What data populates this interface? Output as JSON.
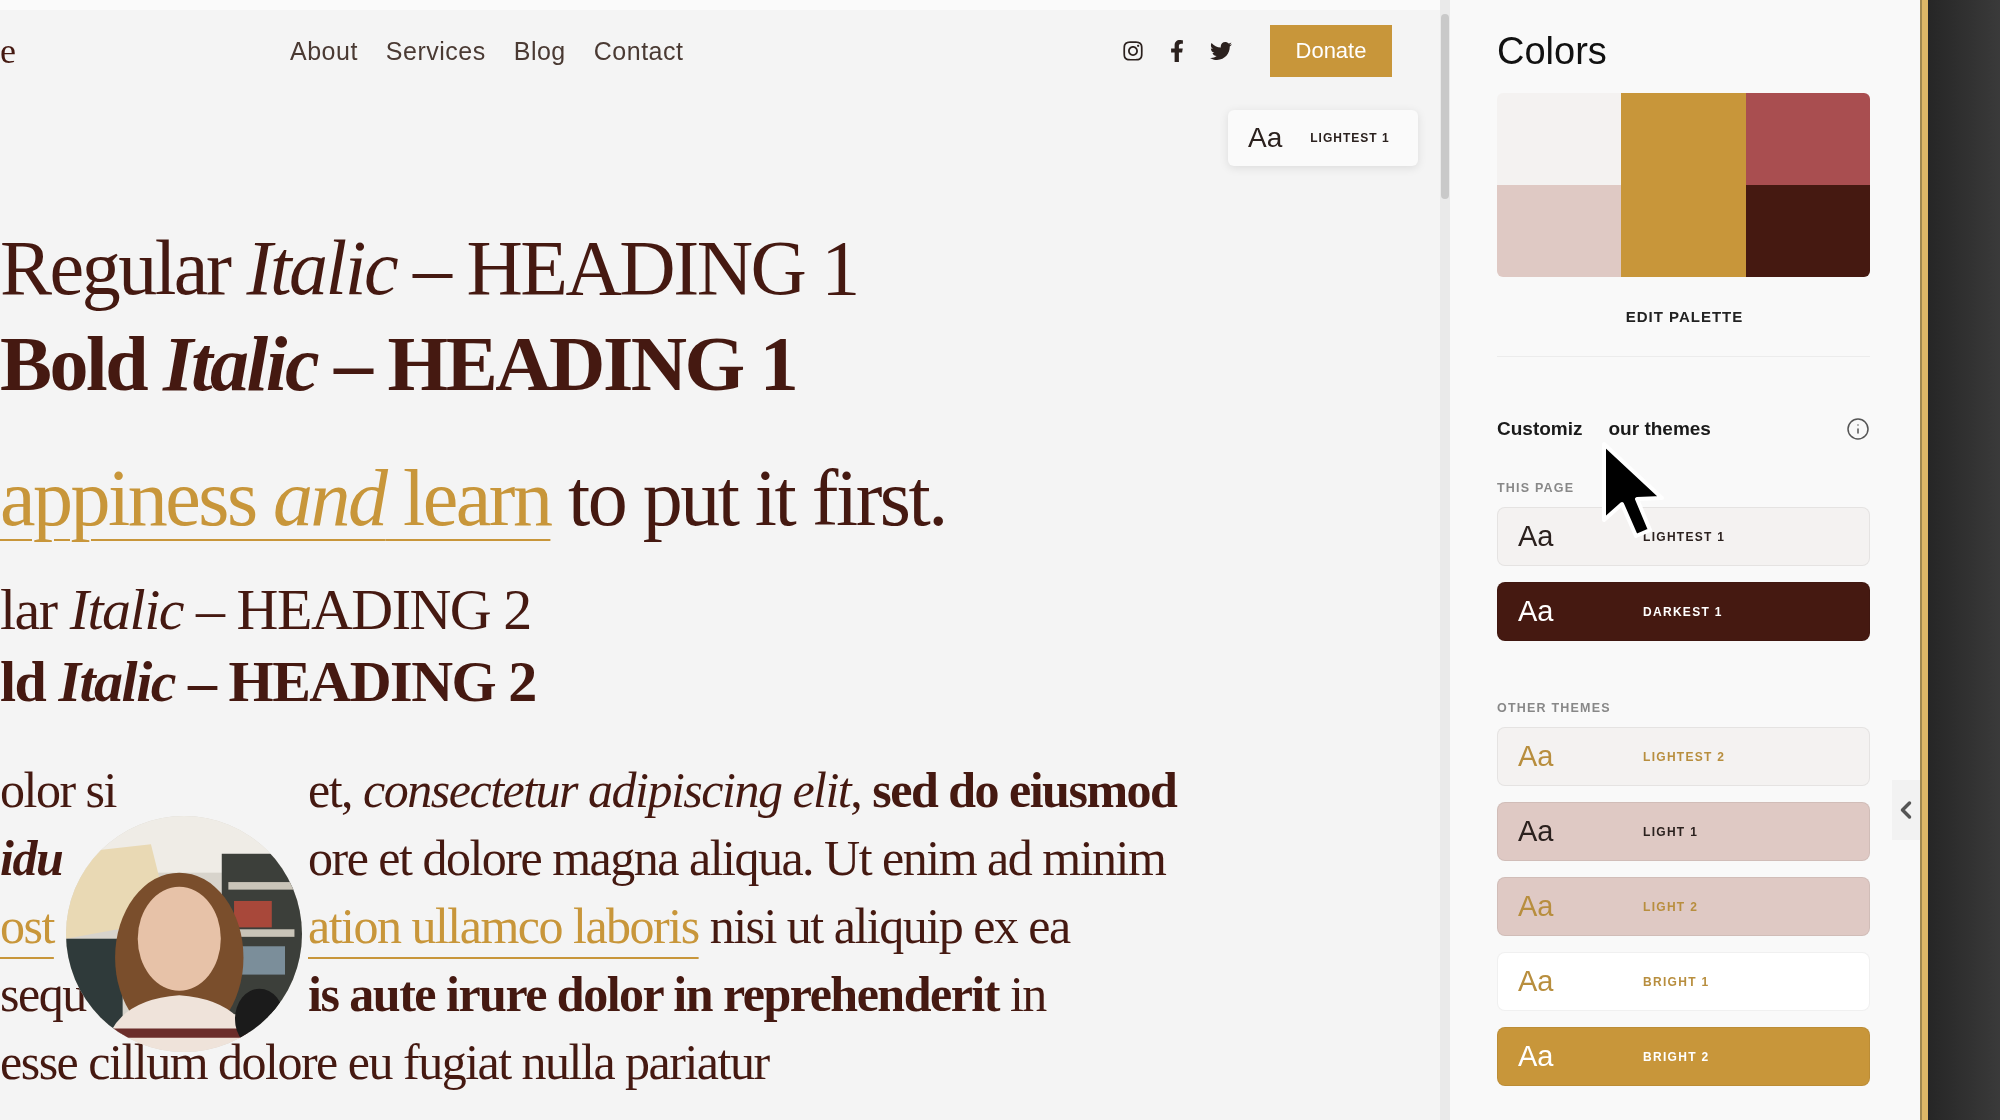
{
  "site": {
    "logo": "e",
    "nav": [
      "About",
      "Services",
      "Blog",
      "Contact"
    ],
    "donate": "Donate",
    "theme_badge": {
      "sample": "Aa",
      "label": "LIGHTEST 1"
    },
    "headings": [
      {
        "kind": "h1",
        "text": "Regular *Italic* – HEADING 1"
      },
      {
        "kind": "h1-bold",
        "text": "Bold *Italic* – HEADING 1"
      }
    ],
    "tagline": [
      {
        "kind": "link",
        "text": "appiness *and* learn"
      },
      {
        "kind": "plain",
        "text": " to put it first."
      }
    ],
    "subheadings": [
      {
        "kind": "h2",
        "text": "lar *Italic* – HEADING 2"
      },
      {
        "kind": "h2-bold",
        "text": "ld *Italic* – HEADING 2"
      }
    ],
    "paragraph_lines": [
      {
        "left": [
          {
            "kind": "plain",
            "text": "olor si"
          }
        ],
        "right": [
          {
            "kind": "plain",
            "text": "et, *consectetur adipiscing elit*, **sed do eiusmod**"
          }
        ]
      },
      {
        "left": [
          {
            "kind": "emphasis",
            "text": "idu"
          }
        ],
        "right": [
          {
            "kind": "plain",
            "text": "ore et dolore magna aliqua. Ut enim ad minim"
          }
        ]
      },
      {
        "left": [
          {
            "kind": "link",
            "text": "ost"
          }
        ],
        "right": [
          {
            "kind": "link",
            "text": "ation ullamco laboris"
          },
          {
            "kind": "plain",
            "text": " nisi ut aliquip ex ea"
          }
        ]
      },
      {
        "left": [
          {
            "kind": "plain",
            "text": "sequ"
          }
        ],
        "right": [
          {
            "kind": "plain",
            "text": "**is aute irure dolor in reprehenderit** in"
          }
        ]
      },
      {
        "left": [
          {
            "kind": "plain",
            "text": "esse cillum dolore eu fugiat nulla pariatur"
          }
        ]
      }
    ],
    "webcam": {
      "kind": "picture"
    }
  },
  "panel": {
    "title": "Colors",
    "palette": [
      {
        "color": "#f4f2f1"
      },
      {
        "color": "#dfc9c4"
      },
      {
        "color": "#c8963a"
      },
      {
        "color": "#a94e50"
      },
      {
        "color": "#451911"
      }
    ],
    "edit_palette": "EDIT PALETTE",
    "customize": {
      "before_cursor": "Customiz",
      "after_cursor": "our themes"
    },
    "sections": [
      {
        "heading": "THIS PAGE",
        "themes": [
          {
            "sample": "Aa",
            "label": "LIGHTEST 1",
            "color": "#f4f2f1",
            "kind": "dark-text"
          },
          {
            "sample": "Aa",
            "label": "DARKEST 1",
            "color": "#451911",
            "kind": "white-text"
          }
        ]
      },
      {
        "heading": "OTHER THEMES",
        "themes": [
          {
            "sample": "Aa",
            "label": "LIGHTEST 2",
            "color": "#f4f2f1",
            "kind": "gold-text"
          },
          {
            "sample": "Aa",
            "label": "LIGHT 1",
            "color": "#dfc9c4",
            "kind": "dark-text"
          },
          {
            "sample": "Aa",
            "label": "LIGHT 2",
            "color": "#dfc9c4",
            "kind": "gold-text"
          },
          {
            "sample": "Aa",
            "label": "BRIGHT 1",
            "color": "#ffffff",
            "kind": "gold-text"
          },
          {
            "sample": "Aa",
            "label": "BRIGHT 2",
            "color": "#c8963a",
            "kind": "white-text"
          }
        ]
      }
    ]
  }
}
